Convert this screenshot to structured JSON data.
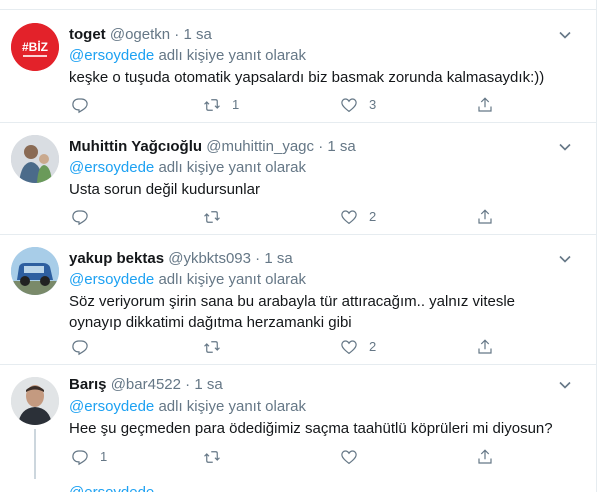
{
  "reply_prefix": "adlı kişiye yanıt olarak",
  "tweets": [
    {
      "name": "toget",
      "handle": "@ogetkn",
      "time": "1 sa",
      "mention": "@ersoydede",
      "text": "keşke o tuşuda otomatik yapsalardı biz basmak zorunda kalmasaydık:))",
      "reply_count": "",
      "retweet_count": "1",
      "like_count": "3",
      "avatar_text": "#BİZ"
    },
    {
      "name": "Muhittin Yağcıoğlu",
      "handle": "@muhittin_yagc",
      "time": "1 sa",
      "mention": "@ersoydede",
      "text": "Usta sorun değil kudursunlar",
      "reply_count": "",
      "retweet_count": "",
      "like_count": "2"
    },
    {
      "name": "yakup bektas",
      "handle": "@ykbkts093",
      "time": "1 sa",
      "mention": "@ersoydede",
      "text": "Söz veriyorum şirin sana bu arabayla tür attıracağım.. yalnız vitesle oynayıp dikkatimi dağıtma herzamanki gibi",
      "reply_count": "",
      "retweet_count": "",
      "like_count": "2"
    },
    {
      "name": "Barış",
      "handle": "@bar4522",
      "time": "1 sa",
      "mention": "@ersoydede",
      "text": "Hee şu geçmeden para ödediğimiz saçma taahütlü köprüleri mi diyosun?",
      "reply_count": "1",
      "retweet_count": "",
      "like_count": ""
    }
  ],
  "partial_next_mention": "@ersoydede",
  "colors": {
    "link": "#1da1f2",
    "secondary_text": "#657786",
    "border": "#e6ecf0",
    "avatar_red": "#e3222a"
  },
  "icons": [
    "reply-icon",
    "retweet-icon",
    "like-icon",
    "share-icon",
    "caret-down-icon"
  ]
}
